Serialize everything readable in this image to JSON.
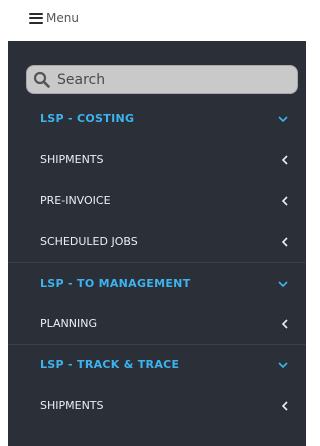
{
  "topbar": {
    "menu_label": "Menu"
  },
  "search": {
    "placeholder": "Search"
  },
  "sidebar": {
    "sections": [
      {
        "title": "LSP - COSTING",
        "items": [
          {
            "label": "SHIPMENTS"
          },
          {
            "label": "PRE-INVOICE"
          },
          {
            "label": "SCHEDULED JOBS"
          }
        ]
      },
      {
        "title": "LSP - TO MANAGEMENT",
        "items": [
          {
            "label": "PLANNING"
          }
        ]
      },
      {
        "title": "LSP - TRACK & TRACE",
        "items": [
          {
            "label": "SHIPMENTS"
          }
        ]
      }
    ]
  },
  "colors": {
    "sidebar_bg": "#2b3038",
    "section_title": "#3db3f0",
    "item_text": "#eceff3"
  }
}
